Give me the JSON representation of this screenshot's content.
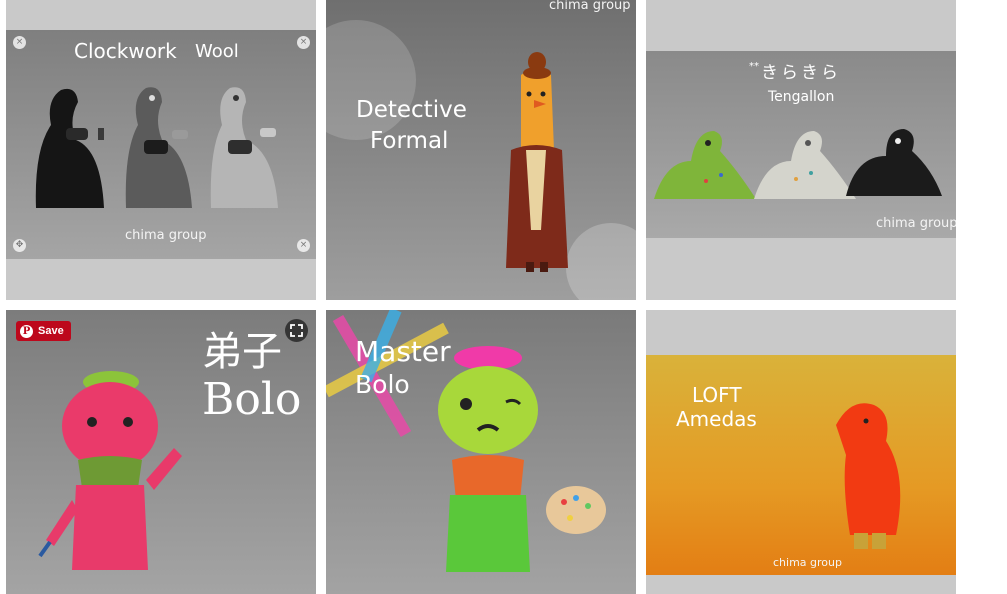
{
  "tiles": [
    {
      "caption_left": "Clockwork",
      "caption_right": "Wool",
      "watermark": "chima group"
    },
    {
      "top_watermark": "chima group",
      "caption_line1": "Detective",
      "caption_line2": "Formal"
    },
    {
      "caption_jp": "きらきら",
      "caption_jp_marks": "**",
      "caption_en": "Tengallon",
      "watermark": "chima group"
    },
    {
      "caption_jp": "弟子",
      "caption_en": "Bolo"
    },
    {
      "caption_line1": "Master",
      "caption_line2": "Bolo"
    },
    {
      "caption_line1": "LOFT",
      "caption_line2": "Amedas",
      "watermark": "chima group"
    }
  ],
  "pin": {
    "save_label": "Save",
    "pinterest_glyph": "P"
  },
  "icons": {
    "close": "×",
    "move": "✥"
  },
  "colors": {
    "tile_background": "#c9c9c9",
    "pinterest_red": "#bd081c",
    "photo_grey": "#8a8a8a",
    "amedas_orange": "#e48a1c"
  }
}
